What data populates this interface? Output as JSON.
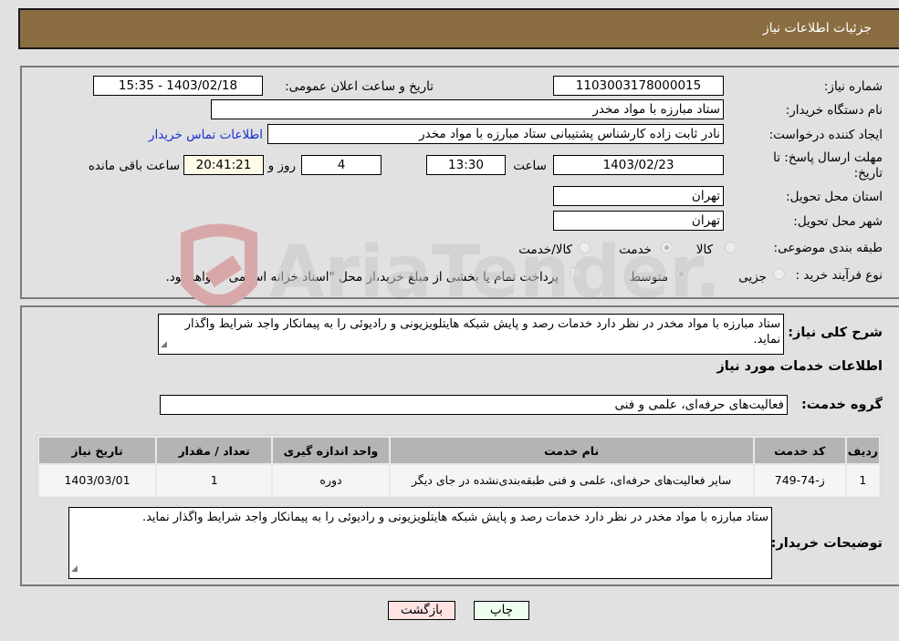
{
  "header": {
    "title": "جزئیات اطلاعات نیاز"
  },
  "details": {
    "need_number_label": "شماره نیاز:",
    "need_number": "1103003178000015",
    "announce_label": "تاریخ و ساعت اعلان عمومی:",
    "announce_value": "1403/02/18 - 15:35",
    "buyer_org_label": "نام دستگاه خریدار:",
    "buyer_org": "ستاد مبارزه با مواد مخدر",
    "creator_label": "ایجاد کننده درخواست:",
    "creator": "نادر ثابت زاده کارشناس پشتیبانی ستاد مبارزه با مواد مخدر",
    "contact_link": "اطلاعات تماس خریدار",
    "deadline_label": "مهلت ارسال پاسخ: تا تاریخ:",
    "deadline_date": "1403/02/23",
    "time_label": "ساعت",
    "deadline_time": "13:30",
    "days": "4",
    "days_label": "روز و",
    "remaining": "20:41:21",
    "remaining_label": "ساعت باقی مانده",
    "province_label": "استان محل تحویل:",
    "province": "تهران",
    "city_label": "شهر محل تحویل:",
    "city": "تهران",
    "category_label": "طبقه بندی موضوعی:",
    "category_options": [
      {
        "label": "کالا",
        "checked": false
      },
      {
        "label": "خدمت",
        "checked": true
      },
      {
        "label": "کالا/خدمت",
        "checked": false
      }
    ],
    "process_label": "نوع فرآیند خرید :",
    "process_options": [
      {
        "label": "جزیی",
        "checked": false
      },
      {
        "label": "متوسط",
        "checked": true
      }
    ],
    "treasury_note": "پرداخت تمام یا بخشی از مبلغ خرید،از محل \"اسناد خزانه اسلامی\" خواهد بود."
  },
  "description": {
    "label": "شرح کلی نیاز:",
    "text": "ستاد مبارزه با مواد مخدر در نظر دارد خدمات رصد و پایش شبکه هایتلویزیونی و رادیوئی را به پیمانکار واجد شرایط واگذار نماید."
  },
  "services": {
    "section_title": "اطلاعات خدمات مورد نیاز",
    "group_label": "گروه خدمت:",
    "group_value": "فعالیت‌های حرفه‌ای، علمی و فنی",
    "table": {
      "headers": [
        "ردیف",
        "کد خدمت",
        "نام خدمت",
        "واحد اندازه گیری",
        "تعداد / مقدار",
        "تاریخ نیاز"
      ],
      "rows": [
        [
          "1",
          "ز-74-749",
          "سایر فعالیت‌های حرفه‌ای، علمی و فنی طبقه‌بندی‌نشده در جای دیگر",
          "دوره",
          "1",
          "1403/03/01"
        ]
      ]
    }
  },
  "buyer_notes": {
    "label": "توضیحات خریدار:",
    "text": "ستاد مبارزه با مواد مخدر در نظر دارد خدمات رصد و پایش شبکه هایتلویزیونی و رادیوئی را به پیمانکار واجد شرایط واگذار نماید."
  },
  "buttons": {
    "print": "چاپ",
    "back": "بازگشت"
  },
  "watermark": {
    "text": "AriaTender.net"
  }
}
